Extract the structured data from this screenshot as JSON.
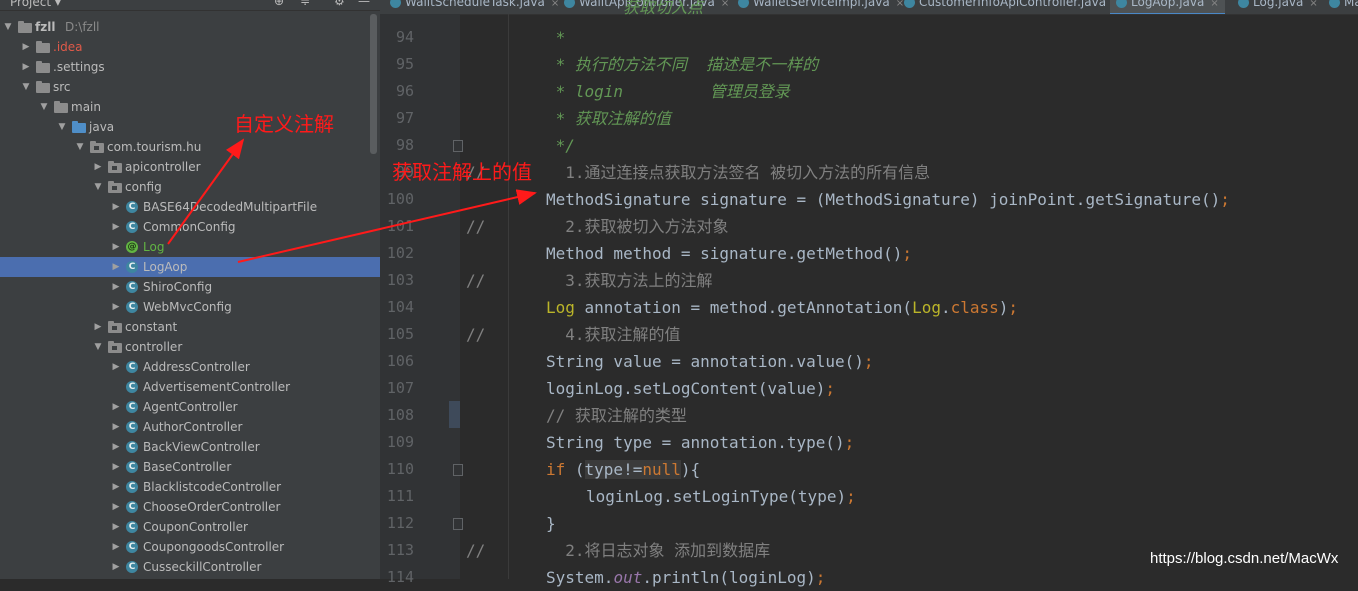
{
  "project_panel": {
    "title": "Project",
    "dropdown_icon": "▾",
    "toolbar_icons": [
      "⊕",
      "≑",
      "⚙",
      "—"
    ],
    "tree": [
      {
        "label": "fzll",
        "hint": "D:\\fzll",
        "level": 0,
        "kind": "folder",
        "expanded": true,
        "bold": true
      },
      {
        "label": ".idea",
        "level": 1,
        "kind": "folder",
        "expanded": false,
        "color": "red"
      },
      {
        "label": ".settings",
        "level": 1,
        "kind": "folder",
        "expanded": false
      },
      {
        "label": "src",
        "level": 1,
        "kind": "folder",
        "expanded": true
      },
      {
        "label": "main",
        "level": 2,
        "kind": "folder",
        "expanded": true
      },
      {
        "label": "java",
        "level": 3,
        "kind": "folder-blue",
        "expanded": true
      },
      {
        "label": "com.tourism.hu",
        "level": 4,
        "kind": "package",
        "expanded": true
      },
      {
        "label": "apicontroller",
        "level": 5,
        "kind": "package",
        "expanded": false
      },
      {
        "label": "config",
        "level": 5,
        "kind": "package",
        "expanded": true
      },
      {
        "label": "BASE64DecodedMultipartFile",
        "level": 6,
        "kind": "class",
        "expanded": false
      },
      {
        "label": "CommonConfig",
        "level": 6,
        "kind": "class",
        "expanded": false
      },
      {
        "label": "Log",
        "level": 6,
        "kind": "annotation",
        "expanded": false
      },
      {
        "label": "LogAop",
        "level": 6,
        "kind": "class",
        "expanded": false,
        "selected": true
      },
      {
        "label": "ShiroConfig",
        "level": 6,
        "kind": "class",
        "expanded": false
      },
      {
        "label": "WebMvcConfig",
        "level": 6,
        "kind": "class",
        "expanded": false
      },
      {
        "label": "constant",
        "level": 5,
        "kind": "package",
        "expanded": false
      },
      {
        "label": "controller",
        "level": 5,
        "kind": "package",
        "expanded": true
      },
      {
        "label": "AddressController",
        "level": 6,
        "kind": "class",
        "expanded": false
      },
      {
        "label": "AdvertisementController",
        "level": 6,
        "kind": "class",
        "expanded": null
      },
      {
        "label": "AgentController",
        "level": 6,
        "kind": "class",
        "expanded": false
      },
      {
        "label": "AuthorController",
        "level": 6,
        "kind": "class",
        "expanded": false
      },
      {
        "label": "BackViewController",
        "level": 6,
        "kind": "class",
        "expanded": false
      },
      {
        "label": "BaseController",
        "level": 6,
        "kind": "class",
        "expanded": false
      },
      {
        "label": "BlacklistcodeController",
        "level": 6,
        "kind": "class",
        "expanded": false
      },
      {
        "label": "ChooseOrderController",
        "level": 6,
        "kind": "class",
        "expanded": false
      },
      {
        "label": "CouponController",
        "level": 6,
        "kind": "class",
        "expanded": false
      },
      {
        "label": "CoupongoodsController",
        "level": 6,
        "kind": "class",
        "expanded": false
      },
      {
        "label": "CusseckillController",
        "level": 6,
        "kind": "class",
        "expanded": false
      }
    ]
  },
  "editor": {
    "tabs": [
      {
        "label": "WalltScheduleTask.java",
        "active": false
      },
      {
        "label": "WalltApiController.java",
        "active": false
      },
      {
        "label": "WalletServiceImpl.java",
        "active": false
      },
      {
        "label": "CustomerInfoApiController.java",
        "active": false
      },
      {
        "label": "LogAop.java",
        "active": true
      },
      {
        "label": "Log.java",
        "active": false
      },
      {
        "label": "Ma",
        "active": false
      }
    ],
    "lines": [
      {
        "n": "94",
        "indent": 0,
        "parts": [
          {
            "t": " *",
            "c": "doc"
          }
        ],
        "fold": false
      },
      {
        "n": "95",
        "indent": 0,
        "parts": [
          {
            "t": " * 执行的方法不同  描述是不一样的",
            "c": "doc"
          }
        ]
      },
      {
        "n": "96",
        "indent": 0,
        "parts": [
          {
            "t": " * login         管理员登录",
            "c": "doc"
          }
        ]
      },
      {
        "n": "97",
        "indent": 0,
        "parts": [
          {
            "t": " * 获取注解的值",
            "c": "doc"
          }
        ]
      },
      {
        "n": "98",
        "indent": 0,
        "parts": [
          {
            "t": " */",
            "c": "doc"
          }
        ],
        "fold": true
      },
      {
        "n": "99",
        "indent": 0,
        "parts": [
          {
            "t": "  1.通过连接点获取方法签名 被切入方法的所有信息",
            "c": "comment"
          }
        ],
        "slashes": true
      },
      {
        "n": "100",
        "indent": 0,
        "parts": [
          {
            "t": "MethodSignature signature = (MethodSignature) joinPoint.getSignature()",
            "c": ""
          },
          {
            "t": ";",
            "c": "kw"
          }
        ]
      },
      {
        "n": "101",
        "indent": 0,
        "parts": [
          {
            "t": "  2.获取被切入方法对象",
            "c": "comment"
          }
        ],
        "slashes": true
      },
      {
        "n": "102",
        "indent": 0,
        "parts": [
          {
            "t": "Method method = signature.getMethod()",
            "c": ""
          },
          {
            "t": ";",
            "c": "kw"
          }
        ]
      },
      {
        "n": "103",
        "indent": 0,
        "parts": [
          {
            "t": "  3.获取方法上的注解",
            "c": "comment"
          }
        ],
        "slashes": true
      },
      {
        "n": "104",
        "indent": 0,
        "parts": [
          {
            "t": "Log",
            "c": "ann"
          },
          {
            "t": " annotation = method.getAnnotation(",
            "c": ""
          },
          {
            "t": "Log",
            "c": "ann"
          },
          {
            "t": ".",
            "c": ""
          },
          {
            "t": "class",
            "c": "kw"
          },
          {
            "t": ")",
            "c": ""
          },
          {
            "t": ";",
            "c": "kw"
          }
        ]
      },
      {
        "n": "105",
        "indent": 0,
        "parts": [
          {
            "t": "  4.获取注解的值",
            "c": "comment"
          }
        ],
        "slashes": true
      },
      {
        "n": "106",
        "indent": 0,
        "parts": [
          {
            "t": "String value = annotation.value()",
            "c": ""
          },
          {
            "t": ";",
            "c": "kw"
          }
        ]
      },
      {
        "n": "107",
        "indent": 0,
        "parts": [
          {
            "t": "loginLog.setLogContent(value)",
            "c": ""
          },
          {
            "t": ";",
            "c": "kw"
          }
        ]
      },
      {
        "n": "108",
        "indent": 0,
        "parts": [
          {
            "t": "// 获取注解的类型",
            "c": "comment"
          }
        ]
      },
      {
        "n": "109",
        "indent": 0,
        "parts": [
          {
            "t": "String type = annotation.type()",
            "c": ""
          },
          {
            "t": ";",
            "c": "kw"
          }
        ]
      },
      {
        "n": "110",
        "indent": 0,
        "parts": [
          {
            "t": "if",
            "c": "kw"
          },
          {
            "t": " (",
            "c": ""
          },
          {
            "t": "type!=",
            "c": "hl"
          },
          {
            "t": "null",
            "c": "kwhl"
          },
          {
            "t": "){",
            "c": ""
          }
        ],
        "fold": true
      },
      {
        "n": "111",
        "indent": 1,
        "parts": [
          {
            "t": "loginLog.setLoginType(type)",
            "c": ""
          },
          {
            "t": ";",
            "c": "kw"
          }
        ]
      },
      {
        "n": "112",
        "indent": 0,
        "parts": [
          {
            "t": "}",
            "c": ""
          }
        ],
        "fold": true
      },
      {
        "n": "113",
        "indent": 0,
        "parts": [
          {
            "t": "  2.将日志对象 添加到数据库",
            "c": "comment"
          }
        ],
        "slashes": true
      },
      {
        "n": "114",
        "indent": 0,
        "parts": [
          {
            "t": "System.",
            "c": ""
          },
          {
            "t": "out",
            "c": "stat"
          },
          {
            "t": ".println(loginLog)",
            "c": ""
          },
          {
            "t": ";",
            "c": "kw"
          }
        ]
      }
    ],
    "partial_top_line": "        获取切入点"
  },
  "annotations": {
    "callout_custom_annotation": "自定义注解",
    "callout_get_value": "获取注解上的值",
    "color": "#ff1a1a"
  },
  "watermark": "https://blog.csdn.net/MacWx"
}
